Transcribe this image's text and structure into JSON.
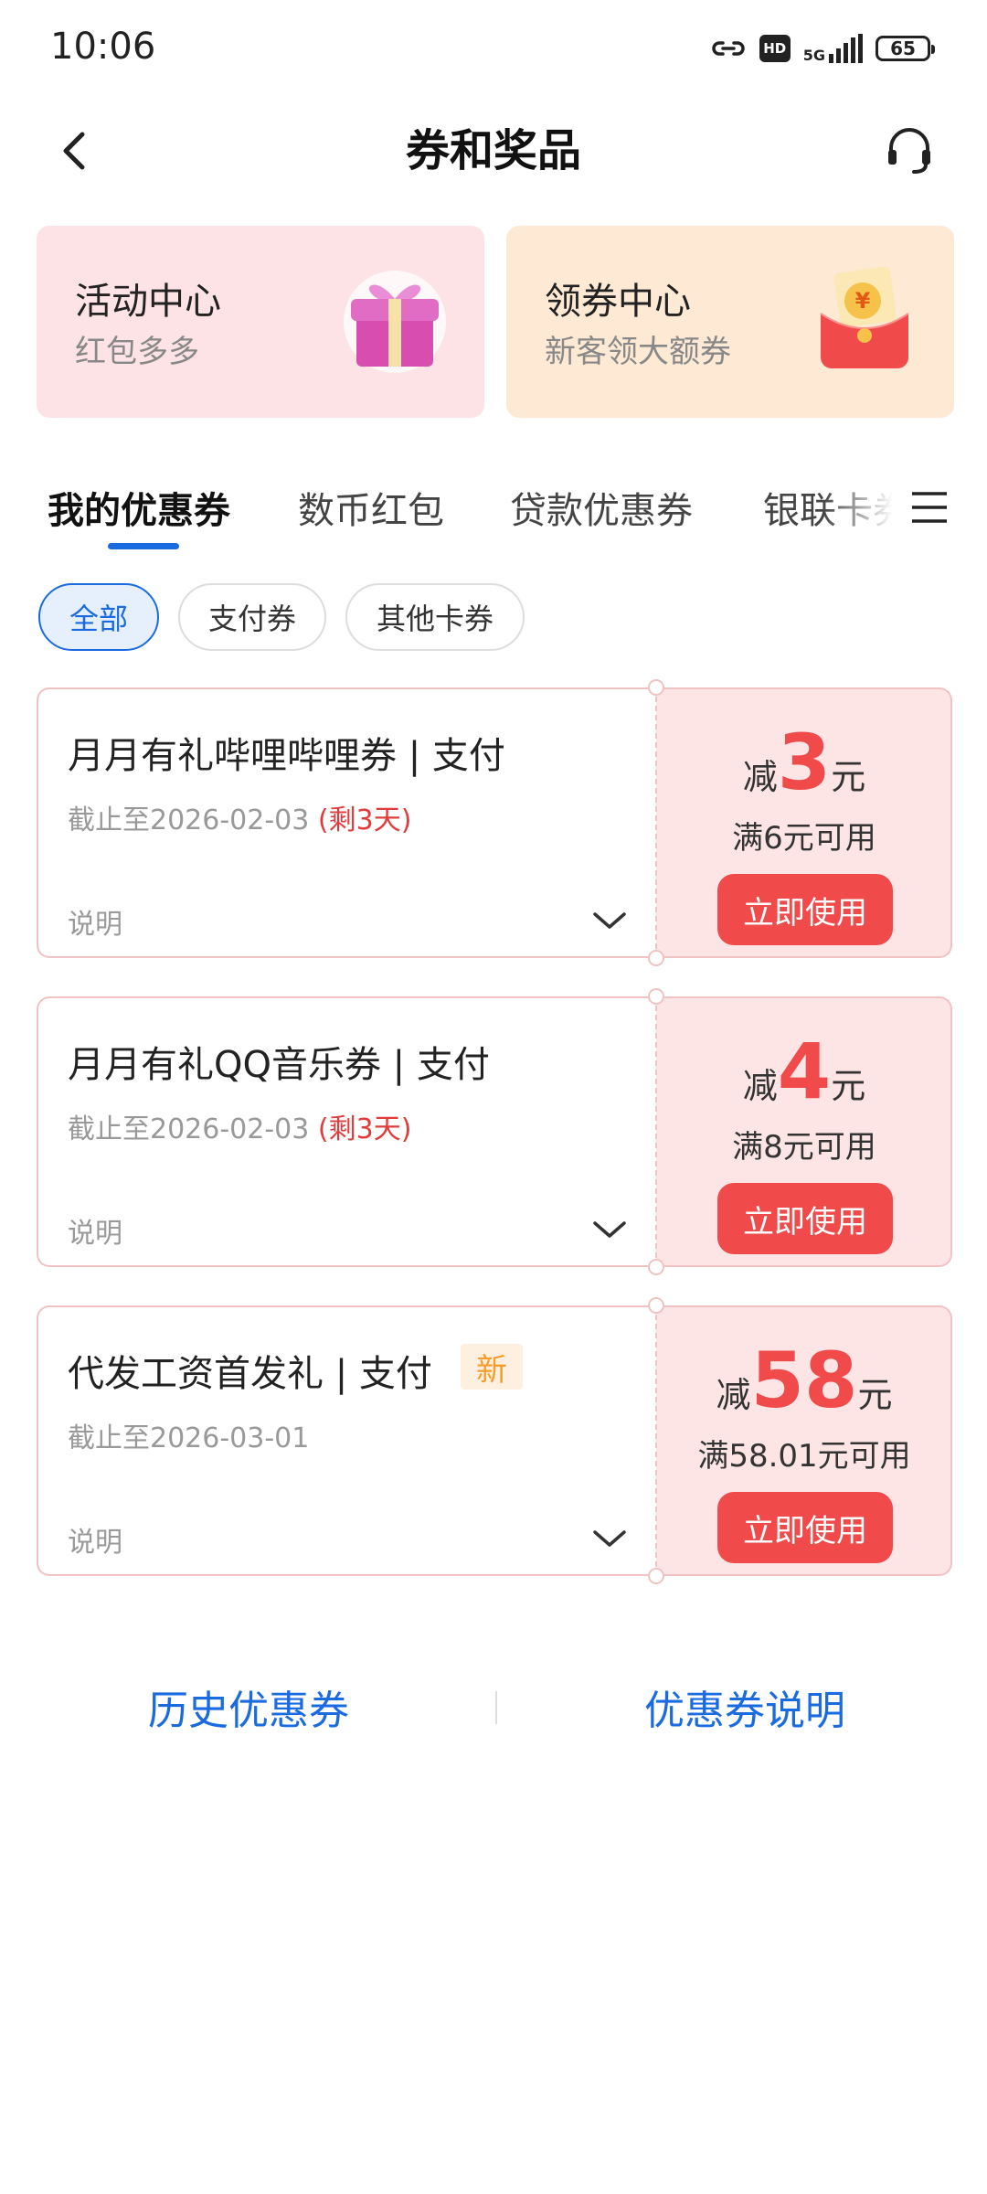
{
  "status_bar": {
    "time": "10:06",
    "hd_label": "HD",
    "network": "5G",
    "battery": "65",
    "signal_level": 4
  },
  "header": {
    "title": "券和奖品",
    "back_icon": "chevron-left-icon",
    "service_icon": "headset-icon"
  },
  "promos": [
    {
      "title": "活动中心",
      "subtitle": "红包多多",
      "icon": "gift-box-icon"
    },
    {
      "title": "领券中心",
      "subtitle": "新客领大额券",
      "icon": "red-envelope-icon"
    }
  ],
  "tabs": [
    {
      "label": "我的优惠券",
      "active": true
    },
    {
      "label": "数币红包",
      "active": false
    },
    {
      "label": "贷款优惠券",
      "active": false
    },
    {
      "label": "银联卡券",
      "active": false
    }
  ],
  "filters": [
    {
      "label": "全部",
      "active": true
    },
    {
      "label": "支付券",
      "active": false
    },
    {
      "label": "其他卡券",
      "active": false
    }
  ],
  "coupons": [
    {
      "title": "月月有礼哔哩哔哩券 | 支付",
      "badge": "",
      "date": "截止至2026-02-03",
      "remain": "(剩3天)",
      "desc": "说明",
      "prefix": "减",
      "amount": "3",
      "suffix": "元",
      "condition": "满6元可用",
      "button": "立即使用"
    },
    {
      "title": "月月有礼QQ音乐券 | 支付",
      "badge": "",
      "date": "截止至2026-02-03",
      "remain": "(剩3天)",
      "desc": "说明",
      "prefix": "减",
      "amount": "4",
      "suffix": "元",
      "condition": "满8元可用",
      "button": "立即使用"
    },
    {
      "title": "代发工资首发礼 | 支付",
      "badge": "新",
      "date": "截止至2026-03-01",
      "remain": "",
      "desc": "说明",
      "prefix": "减",
      "amount": "58",
      "suffix": "元",
      "condition": "满58.01元可用",
      "button": "立即使用"
    }
  ],
  "footer": {
    "history": "历史优惠券",
    "explain": "优惠券说明"
  },
  "colors": {
    "accent": "#1a6ae0",
    "coupon_red": "#f04a4a",
    "remain_red": "#e23b3b",
    "badge_orange": "#f59c2a"
  }
}
